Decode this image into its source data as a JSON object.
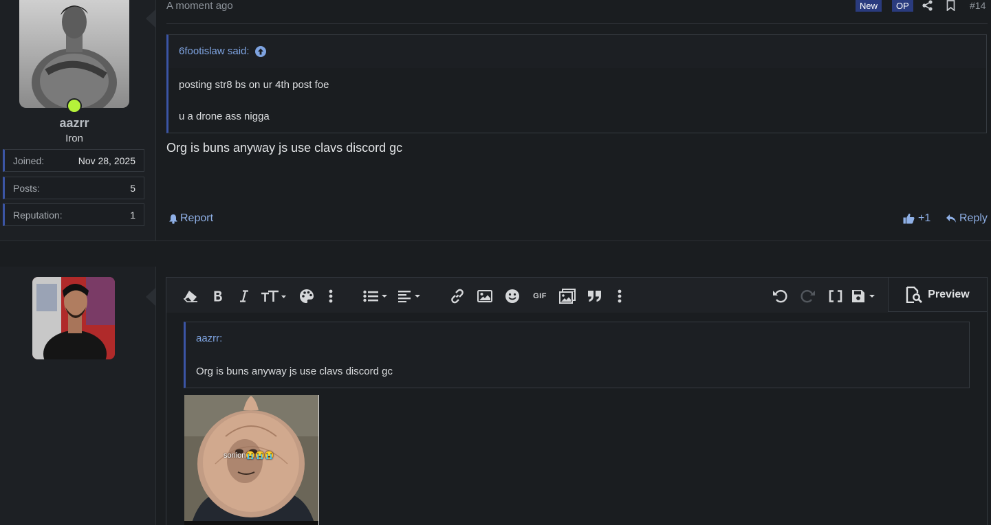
{
  "post1": {
    "username": "aazrr",
    "user_title": "Iron",
    "stats": [
      {
        "label": "Joined:",
        "value": "Nov 28, 2025"
      },
      {
        "label": "Posts:",
        "value": "5"
      },
      {
        "label": "Reputation:",
        "value": "1"
      }
    ],
    "date": "A moment ago",
    "badges": {
      "new": "New",
      "op": "OP"
    },
    "post_number": "#14",
    "quote": {
      "author_line": "6footislaw said:",
      "lines": [
        "posting str8 bs on ur 4th post foe",
        "u a drone ass nigga"
      ]
    },
    "body": "Org is buns anyway js use clavs discord gc",
    "actions": {
      "report": "Report",
      "like_count": "+1",
      "reply": "Reply"
    }
  },
  "editor": {
    "toolbar_icons": [
      "eraser-icon",
      "bold-icon",
      "italic-icon",
      "text-size-icon",
      "palette-icon",
      "more-vertical-icon",
      "list-icon",
      "align-icon",
      "link-icon",
      "image-icon",
      "smile-icon",
      "gif-icon",
      "media-icon",
      "quote-icon",
      "more-vertical-icon",
      "undo-icon",
      "redo-icon",
      "brackets-icon",
      "save-icon"
    ],
    "gif_label": "GIF",
    "preview_label": "Preview",
    "quote": {
      "author_line": "aazrr:",
      "body": "Org is buns anyway js use clavs discord gc"
    },
    "gif_caption": "sonion😭😭😭"
  },
  "colors": {
    "background": "#1a1d20",
    "accent_link": "#8fb0e6",
    "quote_border": "#3b55a6",
    "online": "#b5f23a",
    "badge": "#2a3b7e"
  }
}
